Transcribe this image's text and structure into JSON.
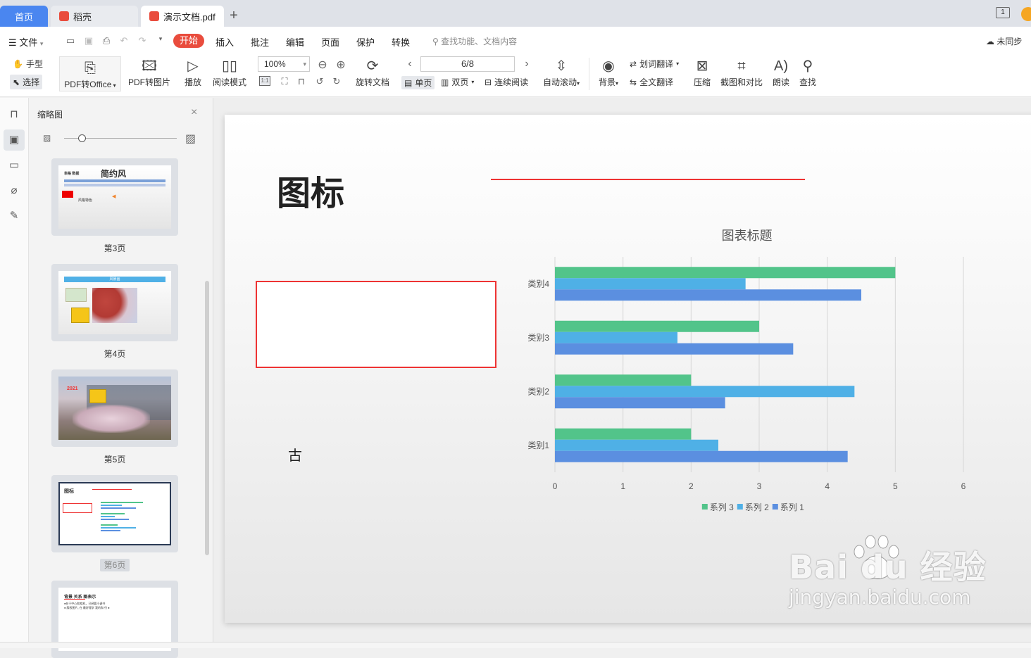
{
  "tabs": {
    "home": "首页",
    "shell": "稻壳",
    "doc": "演示文档.pdf",
    "add": "+",
    "window_badge": "1"
  },
  "menu": {
    "file": "文件",
    "start": "开始",
    "insert": "插入",
    "annotate": "批注",
    "edit": "编辑",
    "page": "页面",
    "protect": "保护",
    "convert": "转换",
    "search_hint": "查找功能、文档内容",
    "sync": "未同步"
  },
  "toolbar": {
    "hand": "手型",
    "select": "选择",
    "pdf_to_office": "PDF转Office",
    "pdf_to_image": "PDF转图片",
    "play": "播放",
    "read_mode": "阅读模式",
    "zoom": "100%",
    "rotate_doc": "旋转文档",
    "page_indicator": "6/8",
    "single_page": "单页",
    "double_page": "双页",
    "continuous": "连续阅读",
    "auto_scroll": "自动滚动",
    "background": "背景",
    "word_translate": "划词翻译",
    "full_translate": "全文翻译",
    "compress": "压缩",
    "screenshot_compare": "截图和对比",
    "read_aloud": "朗读",
    "find": "查找"
  },
  "sidebar": {
    "title": "缩略图",
    "thumbnails": [
      {
        "label": "第3页",
        "title": "简约风",
        "sub": "表格 数据",
        "note": "风格特色"
      },
      {
        "label": "第4页",
        "title": "风景画"
      },
      {
        "label": "第5页",
        "year": "2021"
      },
      {
        "label": "第6页",
        "title": "图标"
      },
      {
        "label": "",
        "title": "背景 关系 图表示",
        "lines": [
          "●在于中心和相机，已经要小调书",
          "● 版权图片, 在 最好理学 我的和 行 ●"
        ]
      }
    ]
  },
  "slide": {
    "title": "图标",
    "glyph": "古"
  },
  "colors": {
    "accent_red": "#e94c3d",
    "tab_blue": "#4a86f0",
    "series3": "#52c48a",
    "series2": "#4fb0e6",
    "series1": "#5b8fe0"
  },
  "chart_data": {
    "type": "bar",
    "orientation": "horizontal",
    "title": "图表标题",
    "categories": [
      "类别1",
      "类别2",
      "类别3",
      "类别4"
    ],
    "series": [
      {
        "name": "系列 1",
        "values": [
          4.3,
          2.5,
          3.5,
          4.5
        ]
      },
      {
        "name": "系列 2",
        "values": [
          2.4,
          4.4,
          1.8,
          2.8
        ]
      },
      {
        "name": "系列 3",
        "values": [
          2,
          2,
          3,
          5
        ]
      }
    ],
    "xlim": [
      0,
      6
    ],
    "xticks": [
      "0",
      "1",
      "2",
      "3",
      "4",
      "5",
      "6"
    ],
    "grid": true,
    "legend": "bottom",
    "legend_order": [
      "系列 3",
      "系列 2",
      "系列 1"
    ]
  },
  "watermark": {
    "top": "Bai du 经验",
    "bottom": "jingyan.baidu.com"
  }
}
